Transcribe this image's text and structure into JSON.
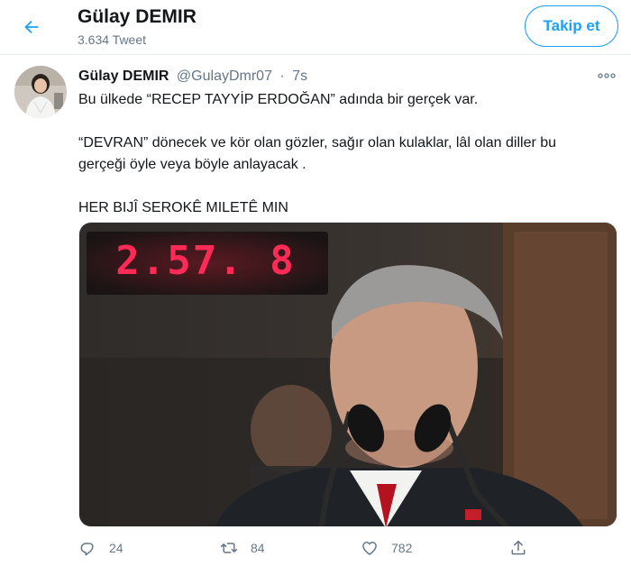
{
  "header": {
    "name": "Gülay DEMIR",
    "tweet_count": "3.634 Tweet",
    "follow_label": "Takip et"
  },
  "tweet": {
    "author_name": "Gülay DEMIR",
    "author_handle": "@GulayDmr07",
    "separator": "·",
    "time": "7s",
    "text": {
      "line1": "Bu ülkede “RECEP TAYYİP ERDOĞAN” adında bir gerçek var.",
      "line2": "“DEVRAN” dönecek ve kör olan gözler, sağır olan kulaklar, lâl olan diller bu",
      "line3": "gerçeği öyle veya böyle anlayacak .",
      "line4": "HER BIJÎ SEROKÊ MILETÊ MIN"
    },
    "media": {
      "display_text": "2.57. 8"
    },
    "stats": {
      "replies": "24",
      "retweets": "84",
      "likes": "782"
    }
  },
  "colors": {
    "accent": "#1da1f2",
    "muted": "#657786",
    "led": "#ff2a55"
  },
  "icons": [
    "back-arrow-icon",
    "more-icon",
    "reply-icon",
    "retweet-icon",
    "like-icon",
    "share-icon"
  ]
}
